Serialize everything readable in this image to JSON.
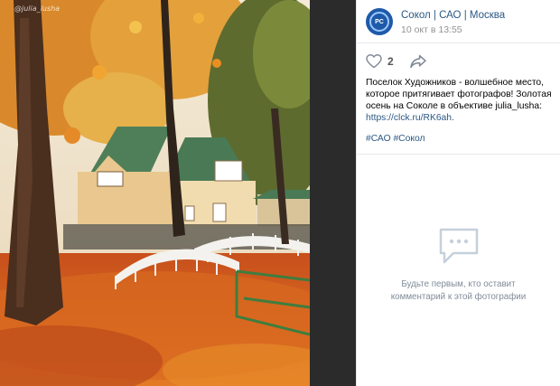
{
  "photo": {
    "watermark": "@julia_lusha",
    "description_icon": "autumn-photo"
  },
  "post": {
    "group_name": "Сокол | САО | Москва",
    "date": "10 окт в 13:55",
    "avatar_text": "PC",
    "likes": "2",
    "text_line1": "Поселок Художников - волшебное место,",
    "text_line2": "которое притягивает фотографов! Золотая",
    "text_line3": "осень на Соколе в объективе julia_lusha:",
    "link": "https://clck.ru/RK6ah.",
    "tags": "#САО #Сокол"
  },
  "comments": {
    "empty_line1": "Будьте первым, кто оставит",
    "empty_line2": "комментарий к этой фотографии"
  },
  "colors": {
    "link": "#2a5885",
    "muted": "#939393",
    "viewer_bg": "#2b2b2b"
  }
}
